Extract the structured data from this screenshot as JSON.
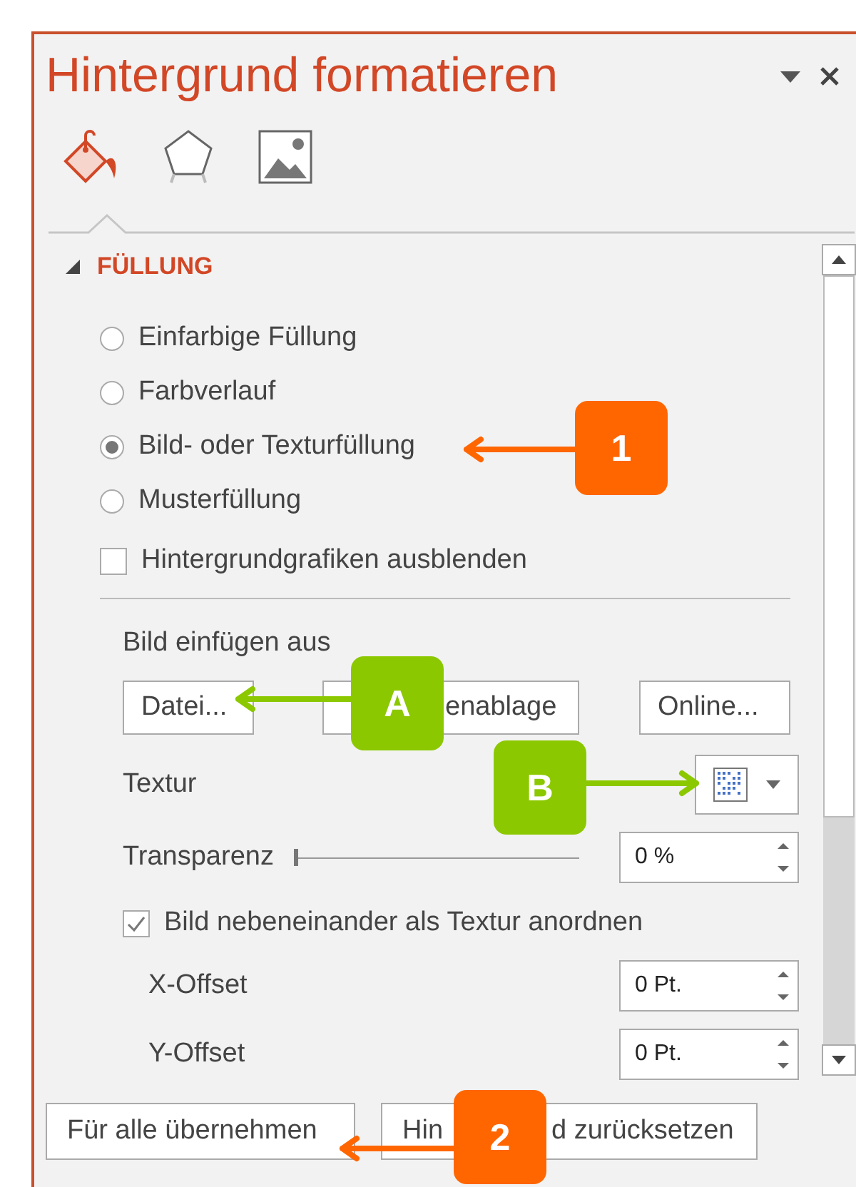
{
  "panel": {
    "title": "Hintergrund formatieren"
  },
  "tabs": [
    {
      "kind": "fill",
      "selected": true
    },
    {
      "kind": "effects",
      "selected": false
    },
    {
      "kind": "picture",
      "selected": false
    }
  ],
  "section": {
    "title": "FÜLLUNG",
    "expanded": true
  },
  "fill_options": [
    {
      "label": "Einfarbige Füllung",
      "selected": false
    },
    {
      "label": "Farbverlauf",
      "selected": false
    },
    {
      "label": "Bild- oder Texturfüllung",
      "selected": true
    },
    {
      "label": "Musterfüllung",
      "selected": false
    }
  ],
  "hide_background_graphics": {
    "label": "Hintergrundgrafiken ausblenden",
    "checked": false
  },
  "insert_from": {
    "label": "Bild einfügen aus",
    "buttons": [
      {
        "label_parts": [
          "Datei..."
        ]
      },
      {
        "label_parts": [
          "enablage"
        ],
        "covered_start": true
      },
      {
        "label_parts": [
          "Online..."
        ]
      }
    ]
  },
  "texture": {
    "label": "Textur"
  },
  "transparency": {
    "label": "Transparenz",
    "level": 0,
    "value": "0 %"
  },
  "tile": {
    "label": "Bild nebeneinander als Textur anordnen",
    "checked": true
  },
  "offsets": [
    {
      "label": "X-Offset",
      "value": "0 Pt."
    },
    {
      "label": "Y-Offset",
      "value": "0 Pt."
    }
  ],
  "footer_buttons": [
    {
      "label_parts": [
        "Für alle übernehmen"
      ]
    },
    {
      "label_parts": [
        "Hin",
        "d zurücksetzen"
      ]
    }
  ],
  "callouts": [
    {
      "label": "1",
      "color": "#ff6600"
    },
    {
      "label": "A",
      "color": "#8cc800"
    },
    {
      "label": "B",
      "color": "#8cc800"
    },
    {
      "label": "2",
      "color": "#ff6600"
    }
  ]
}
